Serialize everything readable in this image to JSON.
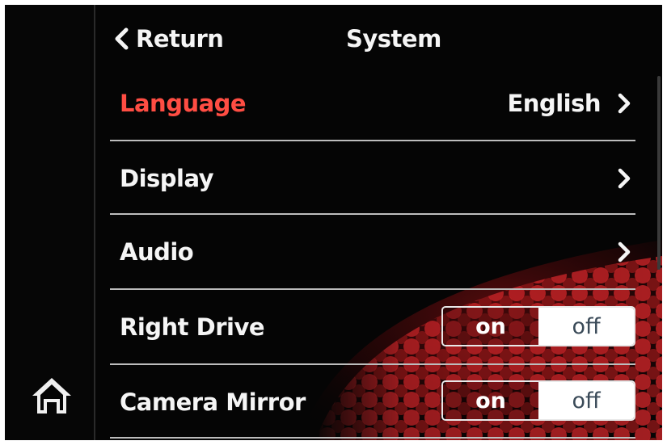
{
  "header": {
    "return_label": "Return",
    "title": "System"
  },
  "rows": [
    {
      "label": "Language",
      "value": "English",
      "active": true,
      "type": "link"
    },
    {
      "label": "Display",
      "type": "link"
    },
    {
      "label": "Audio",
      "type": "link"
    },
    {
      "label": "Right Drive",
      "type": "toggle",
      "on_label": "on",
      "off_label": "off"
    },
    {
      "label": "Camera Mirror",
      "type": "toggle",
      "on_label": "on",
      "off_label": "off"
    }
  ],
  "icons": {
    "home": "home-icon",
    "back": "chevron-left-icon",
    "next": "chevron-right-icon"
  },
  "colors": {
    "active_text": "#ff4d43",
    "text": "#f5f5f5",
    "background": "#050505",
    "decor_red": "#d6262a"
  }
}
